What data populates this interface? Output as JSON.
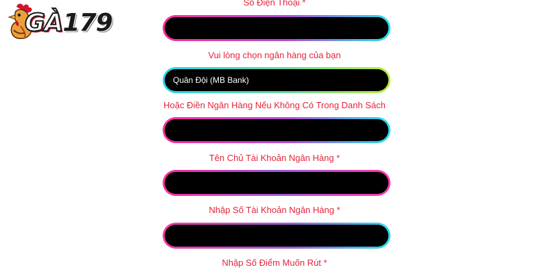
{
  "logo": {
    "text_ga": "GÀ",
    "text_num": "179",
    "accent": "#d4142a",
    "icon": "rooster-icon"
  },
  "form": {
    "phone_label": "Số Điện Thoại *",
    "phone_value": "",
    "bank_select_label": "Vui lòng chọn ngân hàng của bạn",
    "bank_select_value": "Quân Đội (MB Bank)",
    "bank_other_label": "Hoặc Điền Ngân Hàng Nếu Không Có Trong Danh Sách",
    "bank_other_value": "",
    "account_name_label": "Tên Chủ Tài Khoản Ngân Hàng *",
    "account_name_value": "",
    "account_number_label": "Nhập Số Tài Khoản Ngân Hàng *",
    "account_number_value": "",
    "withdraw_points_label": "Nhập Số Điểm Muốn Rút *"
  },
  "colors": {
    "label": "#e5243b",
    "field_bg": "#000000",
    "border_pink": "#ff2d9b",
    "border_cyan": "#22e1f0",
    "border_green": "#b8f03a"
  }
}
